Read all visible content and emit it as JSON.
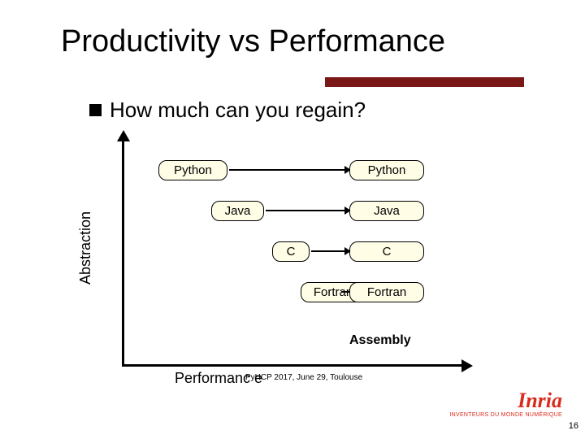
{
  "title": "Productivity vs Performance",
  "bullet": "How much can you regain?",
  "axis": {
    "y": "Abstraction",
    "x": "Performanc\ne"
  },
  "langs": {
    "python": "Python",
    "java": "Java",
    "c": "C",
    "fortran": "Fortran",
    "assembly": "Assembly"
  },
  "footer": "PyHCP 2017, June 29, Toulouse",
  "logo": {
    "name": "Inria",
    "tagline": "INVENTEURS DU MONDE NUMÉRIQUE"
  },
  "page": "16"
}
